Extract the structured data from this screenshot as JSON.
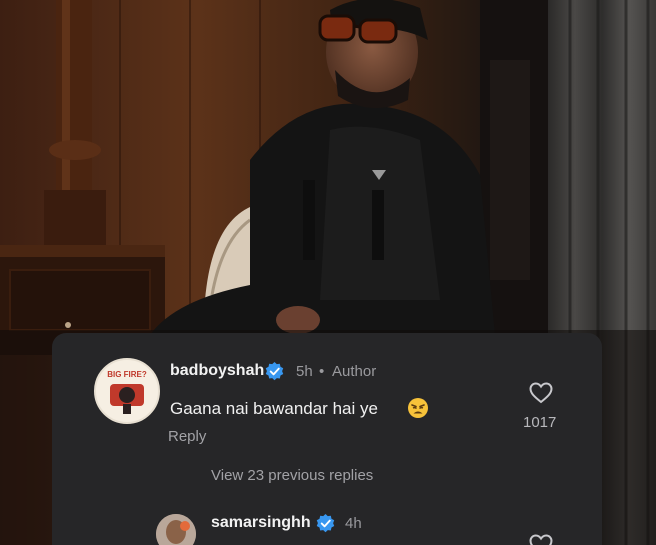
{
  "comment": {
    "username": "badboyshah",
    "time": "5h",
    "separator": "•",
    "author_tag": "Author",
    "text": "Gaana nai bawandar hai ye",
    "reply_label": "Reply",
    "like_count": "1017",
    "verified": true,
    "avatar_label": "BIG FIRE?"
  },
  "replies": {
    "view_label": "View 23 previous replies"
  },
  "reply": {
    "username": "samarsinghh",
    "time": "4h",
    "verified": true
  },
  "icons": {
    "verified": "verified-badge-icon",
    "like": "heart-icon",
    "emoji": "weary-face-emoji"
  },
  "colors": {
    "card_bg": "#262628",
    "verified_blue": "#3897f0",
    "text_primary": "#f2f2f2",
    "text_secondary": "#9a9a9e"
  }
}
